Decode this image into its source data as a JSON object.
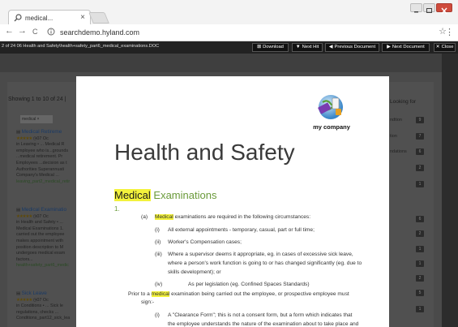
{
  "browser": {
    "tab_title": "medical...",
    "tab_close": "×",
    "url": "searchdemo.hyland.com",
    "back": "←",
    "forward": "→",
    "reload": "C",
    "star": "☆",
    "menu": "⋮"
  },
  "viewer": {
    "breadcrumb": "2 of 24 06 Health and Safety\\health+safety_part6_medical_examinations.DOC",
    "buttons": {
      "download": "Download",
      "next_hit": "Next Hit",
      "previous_document": "Previous Document",
      "next_document": "Next Document",
      "close": "Close"
    }
  },
  "background": {
    "showing": "Showing 1 to 10 of 24 |",
    "filter_chip": "medical ×",
    "results": [
      {
        "title": "Medical Retireme",
        "stars": "★★★★★",
        "date": "07 Oc",
        "lines": [
          "in Leaving • ... Medical R",
          "employee who is...grounds",
          "...medical retirement. Pr",
          "Employees ...decision as t",
          "Authorities Superannuati",
          "Company's Medical ..."
        ],
        "link": "leaving_part2_medical_retir"
      },
      {
        "title": "Medical Examinatio",
        "stars": "★★★★★",
        "date": "07 Oc",
        "lines": [
          "in Health and Safety • ...",
          "Medical Examinations 1.",
          "carried out the employee",
          "makes appointment with",
          "position description to M",
          "undergoes medical exam",
          "factors..."
        ],
        "link": "health+safety_part6_medic"
      },
      {
        "title": "Sick Leave",
        "stars": "★★★★★",
        "date": "07 Oc",
        "lines": [
          "in Conditions • ... Sick le",
          "regulations, checks ...",
          "Conditions_part12_sick_lea"
        ],
        "link": ""
      }
    ],
    "looking_for": "Looking for",
    "facets": [
      {
        "label": "ndtion",
        "count": "9"
      },
      {
        "label": "tion",
        "count": "7"
      },
      {
        "label": "ndations",
        "count": "6"
      },
      {
        "label": "",
        "count": "2"
      },
      {
        "label": "",
        "count": "1"
      },
      {
        "label": "",
        "count": "6"
      },
      {
        "label": "",
        "count": "2"
      },
      {
        "label": "",
        "count": "1"
      },
      {
        "label": "",
        "count": "1"
      },
      {
        "label": "",
        "count": "2"
      },
      {
        "label": "",
        "count": "5"
      },
      {
        "label": "",
        "count": "1"
      }
    ]
  },
  "document": {
    "logo_text": "my company",
    "title": "Health and Safety",
    "heading_highlight": "Medical",
    "heading_rest": " Examinations",
    "section_number": "1.",
    "paragraphs": {
      "a_label": "(a)",
      "a_hl": "Medical",
      "a_rest": " examinations are required in the following circumstances:",
      "i1_label": "(i)",
      "i1_text": "All external appointments - temporary, casual, part or full time;",
      "ii_label": "(ii)",
      "ii_text": "Worker's Compensation cases;",
      "iii_label": "(iii)",
      "iii_line1": "Where a supervisor deems it appropriate, eg. in cases of excessive sick leave,",
      "iii_line2": "where a person's work function is going to or has changed significantly (eg. due to",
      "iii_line3": "skills development); or",
      "iv_label": "(iv)",
      "iv_text": "As per legislation (eg. Confined Spaces Standards)",
      "prior_1": "Prior to a ",
      "prior_hl": "medical",
      "prior_2": " examination being carried out the employee, or prospective employee must",
      "prior_line2": "sign:-",
      "i2_label": "(i)",
      "i2_line1": "A \"Clearance Form\"; this is not a consent form, but a form which indicates that",
      "i2_line2": "the employee understands the nature of the examination about to take place and"
    }
  }
}
